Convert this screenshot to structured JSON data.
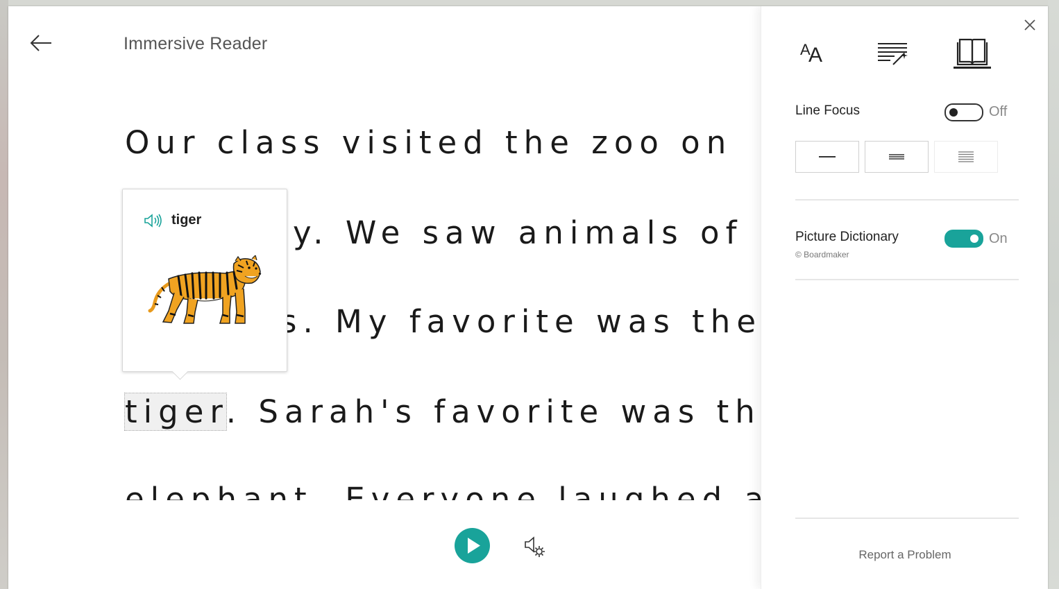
{
  "app": {
    "title": "Immersive Reader"
  },
  "icons": {
    "back": "arrow-left-icon",
    "close": "close-icon",
    "speaker": "speaker-icon",
    "play": "play-icon",
    "voice_settings": "speaker-gear-icon",
    "text_preferences": "text-size-icon",
    "grammar_options": "grammar-wand-icon",
    "reading_preferences": "book-icon",
    "tiger": "tiger-image"
  },
  "reader": {
    "lines": [
      "Our class visited the zoo on",
      "y. We saw animals of",
      "s. My favorite was the",
      ". Sarah's favorite was the",
      "elephant. Everyone laughed a"
    ],
    "highlighted_word": "tiger"
  },
  "popup": {
    "word": "tiger"
  },
  "panel": {
    "line_focus": {
      "label": "Line Focus",
      "state": "Off",
      "enabled": false
    },
    "picture_dictionary": {
      "label": "Picture Dictionary",
      "credit": "© Boardmaker",
      "state": "On",
      "enabled": true
    },
    "report": "Report a Problem"
  },
  "colors": {
    "accent": "#19a39a",
    "text": "#1a1a1a",
    "muted": "#888888"
  }
}
